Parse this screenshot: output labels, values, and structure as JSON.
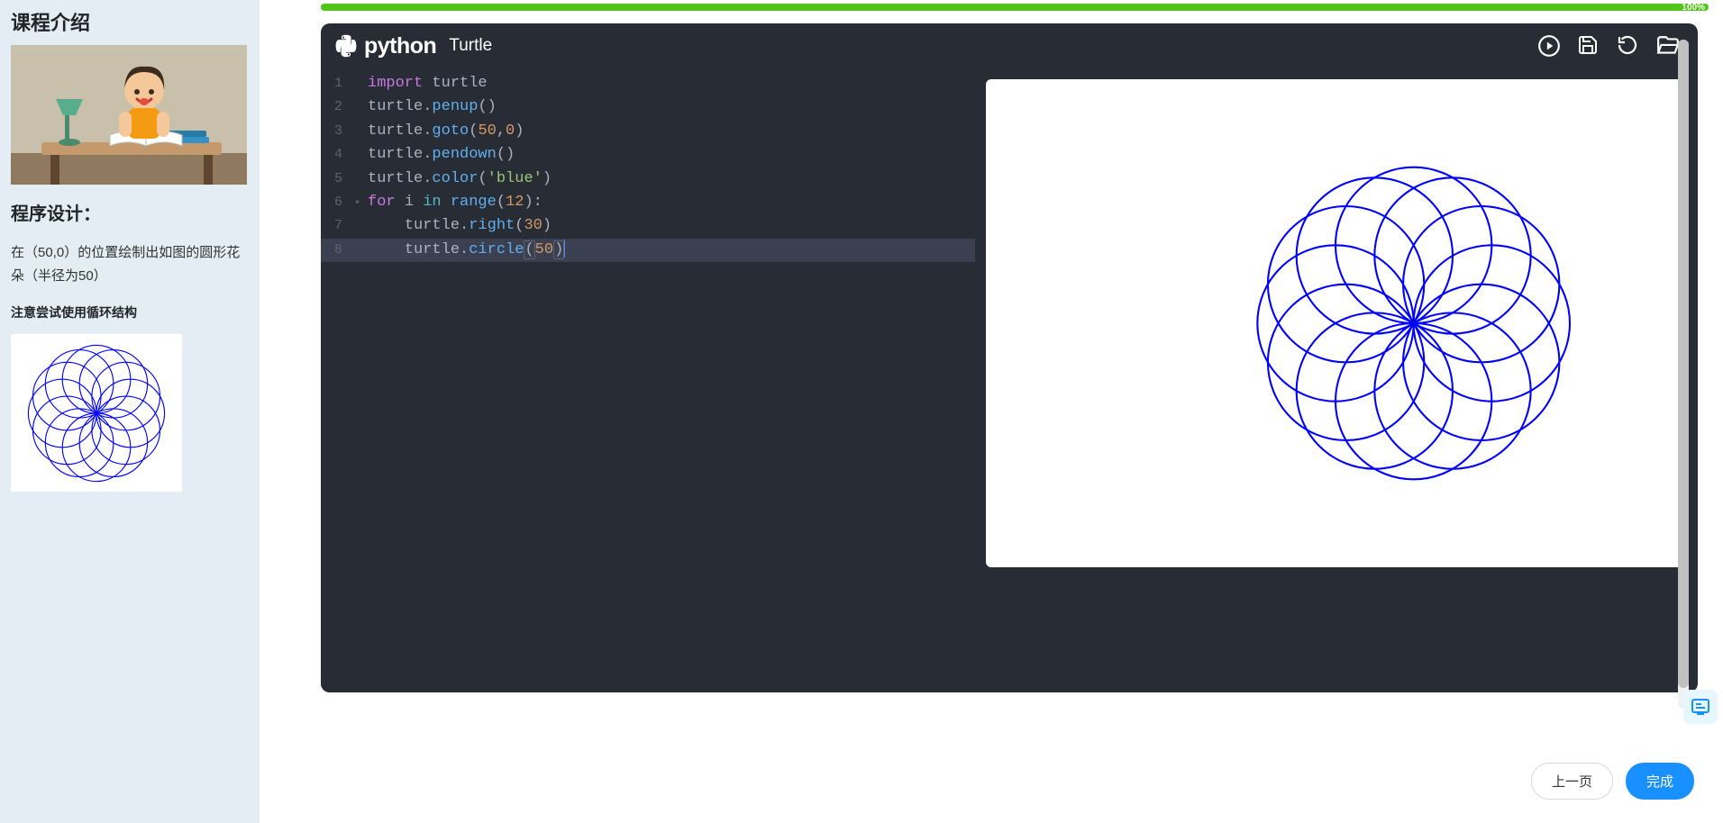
{
  "sidebar": {
    "title": "课程介绍",
    "section_title": "程序设计：",
    "task": "在（50,0）的位置绘制出如图的圆形花朵（半径为50）",
    "hint": "注意尝试使用循环结构"
  },
  "progress": {
    "percent_label": "100%"
  },
  "editor": {
    "brand_word": "python",
    "mode": "Turtle",
    "code_lines": [
      {
        "n": "1",
        "fold": "",
        "tokens": [
          [
            "kw",
            "import"
          ],
          [
            "sp",
            " "
          ],
          [
            "id",
            "turtle"
          ]
        ]
      },
      {
        "n": "2",
        "fold": "",
        "tokens": [
          [
            "id",
            "turtle"
          ],
          [
            "punc",
            "."
          ],
          [
            "fn",
            "penup"
          ],
          [
            "punc",
            "("
          ],
          [
            "punc",
            ")"
          ]
        ]
      },
      {
        "n": "3",
        "fold": "",
        "tokens": [
          [
            "id",
            "turtle"
          ],
          [
            "punc",
            "."
          ],
          [
            "fn",
            "goto"
          ],
          [
            "punc",
            "("
          ],
          [
            "num",
            "50"
          ],
          [
            "punc",
            ","
          ],
          [
            "num",
            "0"
          ],
          [
            "punc",
            ")"
          ]
        ]
      },
      {
        "n": "4",
        "fold": "",
        "tokens": [
          [
            "id",
            "turtle"
          ],
          [
            "punc",
            "."
          ],
          [
            "fn",
            "pendown"
          ],
          [
            "punc",
            "("
          ],
          [
            "punc",
            ")"
          ]
        ]
      },
      {
        "n": "5",
        "fold": "",
        "tokens": [
          [
            "id",
            "turtle"
          ],
          [
            "punc",
            "."
          ],
          [
            "fn",
            "color"
          ],
          [
            "punc",
            "("
          ],
          [
            "str",
            "'blue'"
          ],
          [
            "punc",
            ")"
          ]
        ]
      },
      {
        "n": "6",
        "fold": "▸",
        "tokens": [
          [
            "kw",
            "for"
          ],
          [
            "sp",
            " "
          ],
          [
            "id",
            "i"
          ],
          [
            "sp",
            " "
          ],
          [
            "op",
            "in"
          ],
          [
            "sp",
            " "
          ],
          [
            "fn",
            "range"
          ],
          [
            "punc",
            "("
          ],
          [
            "num",
            "12"
          ],
          [
            "punc",
            ")"
          ],
          [
            "punc",
            ":"
          ]
        ]
      },
      {
        "n": "7",
        "fold": "",
        "tokens": [
          [
            "sp",
            "    "
          ],
          [
            "id",
            "turtle"
          ],
          [
            "punc",
            "."
          ],
          [
            "fn",
            "right"
          ],
          [
            "punc",
            "("
          ],
          [
            "num",
            "30"
          ],
          [
            "punc",
            ")"
          ]
        ]
      },
      {
        "n": "8",
        "fold": "",
        "cursor": true,
        "tokens": [
          [
            "sp",
            "    "
          ],
          [
            "id",
            "turtle"
          ],
          [
            "punc",
            "."
          ],
          [
            "fn",
            "circle"
          ],
          [
            "punc-br",
            "("
          ],
          [
            "num",
            "50"
          ],
          [
            "punc-br",
            ")"
          ],
          [
            "caret",
            ""
          ]
        ]
      }
    ]
  },
  "buttons": {
    "prev": "上一页",
    "done": "完成"
  }
}
